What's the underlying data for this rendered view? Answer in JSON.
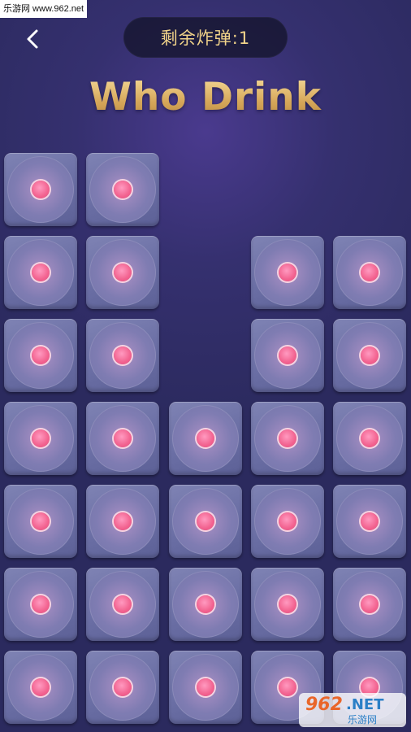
{
  "watermark_top": "乐游网 www.962.net",
  "header": {
    "back_icon": "chevron-left-icon",
    "bombs_label": "剩余炸弹:1"
  },
  "title": "Who Drink",
  "board": {
    "rows": 7,
    "cols": 5,
    "tile_icon": "pink-dot-icon",
    "present": [
      [
        true,
        true,
        false,
        false,
        false
      ],
      [
        true,
        true,
        false,
        true,
        true
      ],
      [
        true,
        true,
        false,
        true,
        true
      ],
      [
        true,
        true,
        true,
        true,
        true
      ],
      [
        true,
        true,
        true,
        true,
        true
      ],
      [
        true,
        true,
        true,
        true,
        true
      ],
      [
        true,
        true,
        true,
        true,
        true
      ]
    ]
  },
  "watermark_corner": {
    "logo": "962",
    "logo_net": ".NET",
    "logo_sub": "乐游网"
  },
  "colors": {
    "background": "#35306f",
    "title_gold": "#d9b06a",
    "pill_text": "#f2d48a",
    "tile": "#6a6ea4",
    "dot": "#f2628f"
  }
}
